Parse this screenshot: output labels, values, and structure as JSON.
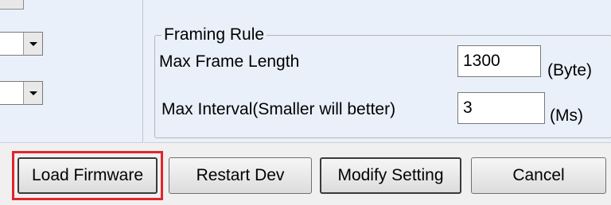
{
  "framing_rule": {
    "title": "Framing Rule",
    "max_frame_length": {
      "label": "Max Frame Length",
      "value": "1300",
      "unit": "(Byte)"
    },
    "max_interval": {
      "label": "Max Interval(Smaller will better)",
      "value": "3",
      "unit": "(Ms)"
    }
  },
  "buttons": {
    "load_firmware": "Load Firmware",
    "restart_dev": "Restart Dev",
    "modify_setting": "Modify Setting",
    "cancel": "Cancel"
  },
  "icons": {
    "combo_arrow": "chevron-down-icon"
  },
  "colors": {
    "panel_bg": "#e9f0fa",
    "highlight": "#e0262c"
  }
}
